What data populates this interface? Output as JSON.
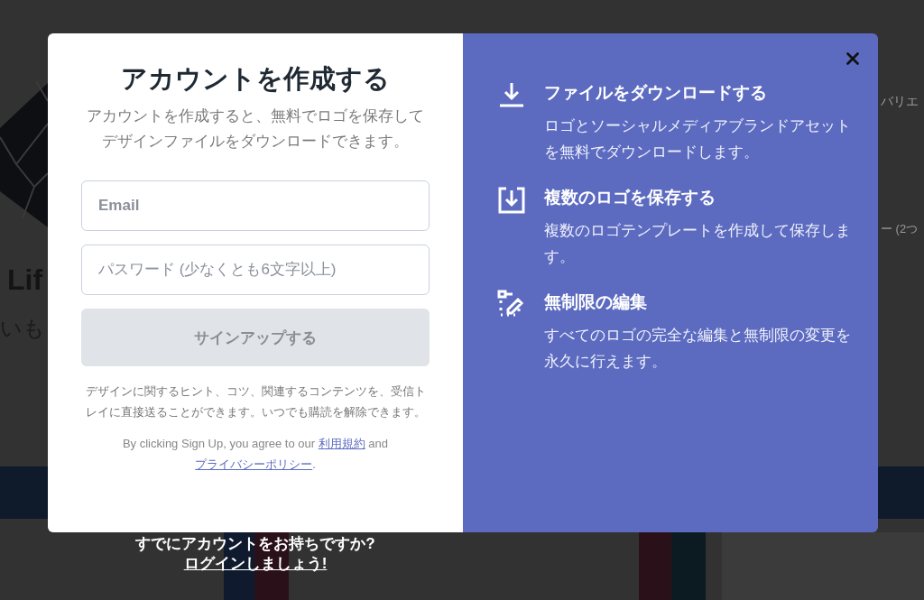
{
  "background_page": {
    "texts": [
      {
        "kind": "heading",
        "text": "Lif"
      },
      {
        "kind": "tagline",
        "text": "いも"
      },
      {
        "kind": "side-top",
        "text": "バリエ"
      },
      {
        "kind": "side-mid",
        "text": "ー (2つ"
      }
    ]
  },
  "modal": {
    "title": "アカウントを作成する",
    "subtitle": "アカウントを作成すると、無料でロゴを保存してデザインファイルをダウンロードできます。",
    "fields": [
      {
        "placeholder": "Email",
        "kind": "email"
      },
      {
        "placeholder": "パスワード (少なくとも6文字以上)",
        "kind": "password"
      }
    ],
    "submit": {
      "label": "サインアップする",
      "disabled": true
    },
    "newsletter_note": "デザインに関するヒント、コツ、関連するコンテンツを、受信トレイに直接送ることができます。いつでも購読を解除できます。",
    "terms": {
      "before": "By clicking Sign Up, you agree to our",
      "terms_link": "利用規約",
      "middle": "and",
      "privacy_link": "プライバシーポリシー",
      "after": "."
    },
    "features": [
      {
        "kind": "download",
        "title": "ファイルをダウンロードする",
        "text": "ロゴとソーシャルメディアブランドアセットを無料でダウンロードします。"
      },
      {
        "kind": "save",
        "title": "複数のロゴを保存する",
        "text": "複数のロゴテンプレートを作成して保存します。"
      },
      {
        "kind": "edit",
        "title": "無制限の編集",
        "text": "すべてのロゴの完全な編集と無制限の変更を永久に行えます。"
      }
    ]
  },
  "footer": {
    "prompt": "すでにアカウントをお持ちですか?",
    "login_link": "ログインしましょう!"
  }
}
